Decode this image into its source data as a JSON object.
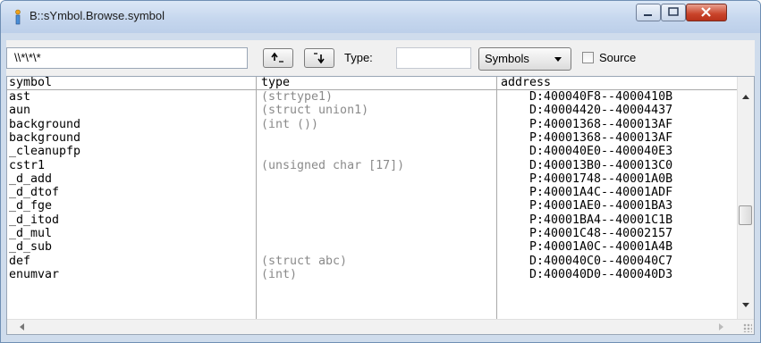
{
  "window": {
    "title": "B::sYmbol.Browse.symbol"
  },
  "toolbar": {
    "search_value": "\\\\*\\*\\*",
    "type_label": "Type:",
    "type_value": "",
    "view_select": "Symbols",
    "source_label": "Source",
    "source_checked": false
  },
  "columns": {
    "symbol": "symbol",
    "type": "type",
    "address": "address"
  },
  "rows": [
    {
      "symbol": "ast",
      "type": "(strtype1)",
      "address": "D:400040F8--4000410B"
    },
    {
      "symbol": "aun",
      "type": "(struct union1)",
      "address": "D:40004420--40004437"
    },
    {
      "symbol": "background",
      "type": "(int ())",
      "address": "P:40001368--400013AF"
    },
    {
      "symbol": "background",
      "type": "",
      "address": "P:40001368--400013AF"
    },
    {
      "symbol": "_cleanupfp",
      "type": "",
      "address": "D:400040E0--400040E3"
    },
    {
      "symbol": "cstr1",
      "type": "(unsigned char [17])",
      "address": "D:400013B0--400013C0"
    },
    {
      "symbol": "_d_add",
      "type": "",
      "address": "P:40001748--40001A0B"
    },
    {
      "symbol": "_d_dtof",
      "type": "",
      "address": "P:40001A4C--40001ADF"
    },
    {
      "symbol": "_d_fge",
      "type": "",
      "address": "P:40001AE0--40001BA3"
    },
    {
      "symbol": "_d_itod",
      "type": "",
      "address": "P:40001BA4--40001C1B"
    },
    {
      "symbol": "_d_mul",
      "type": "",
      "address": "P:40001C48--40002157"
    },
    {
      "symbol": "_d_sub",
      "type": "",
      "address": "P:40001A0C--40001A4B"
    },
    {
      "symbol": "def",
      "type": "(struct abc)",
      "address": "D:400040C0--400040C7"
    },
    {
      "symbol": "enumvar",
      "type": "(int)",
      "address": "D:400040D0--400040D3"
    }
  ]
}
